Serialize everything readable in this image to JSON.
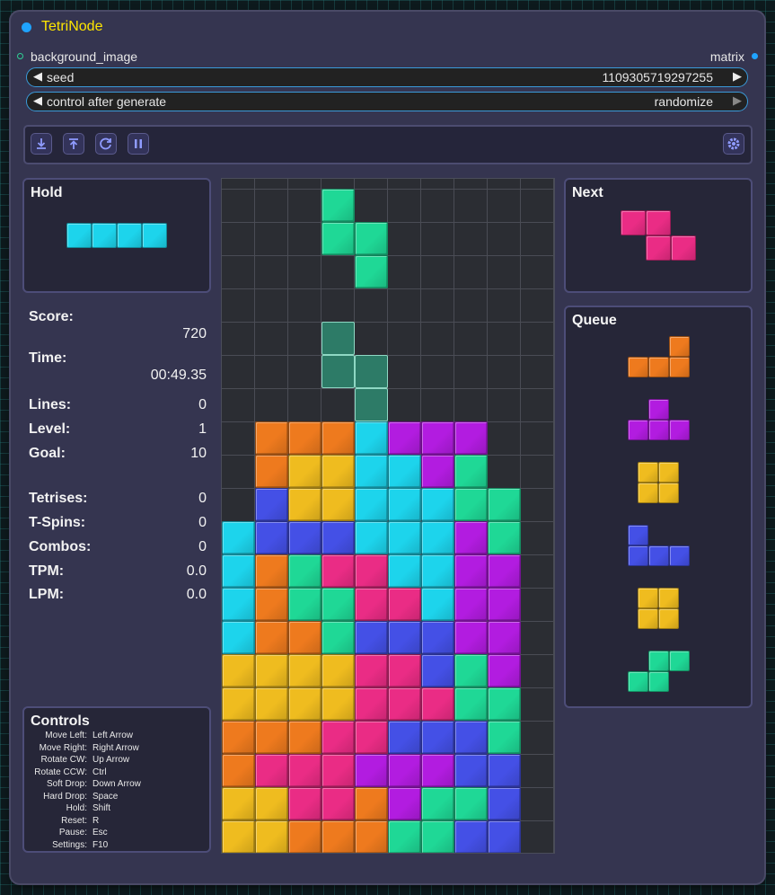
{
  "node": {
    "title": "TetriNode",
    "input_label": "background_image",
    "output_label": "matrix"
  },
  "widgets": {
    "seed": {
      "label": "seed",
      "value": "1109305719297255"
    },
    "control": {
      "label": "control after generate",
      "value": "randomize"
    }
  },
  "toolbar": {
    "icons": [
      "download-icon",
      "upload-icon",
      "reset-icon",
      "pause-icon",
      "gear-icon"
    ]
  },
  "hold": {
    "title": "Hold",
    "piece": "I"
  },
  "next": {
    "title": "Next",
    "piece": "Z"
  },
  "queue": {
    "title": "Queue",
    "pieces": [
      "L",
      "T",
      "O",
      "J",
      "O",
      "S"
    ]
  },
  "stats": {
    "score_label": "Score:",
    "score": "720",
    "time_label": "Time:",
    "time": "00:49.35",
    "lines_label": "Lines:",
    "lines": "0",
    "level_label": "Level:",
    "level": "1",
    "goal_label": "Goal:",
    "goal": "10",
    "tetrises_label": "Tetrises:",
    "tetrises": "0",
    "tspins_label": "T-Spins:",
    "tspins": "0",
    "combos_label": "Combos:",
    "combos": "0",
    "tpm_label": "TPM:",
    "tpm": "0.0",
    "lpm_label": "LPM:",
    "lpm": "0.0"
  },
  "controls": {
    "title": "Controls",
    "items": [
      {
        "action": "Move Left:",
        "key": "Left Arrow"
      },
      {
        "action": "Move Right:",
        "key": "Right Arrow"
      },
      {
        "action": "Rotate CW:",
        "key": "Up Arrow"
      },
      {
        "action": "Rotate CCW:",
        "key": "Ctrl"
      },
      {
        "action": "Soft Drop:",
        "key": "Down Arrow"
      },
      {
        "action": "Hard Drop:",
        "key": "Space"
      },
      {
        "action": "Hold:",
        "key": "Shift"
      },
      {
        "action": "Reset:",
        "key": "R"
      },
      {
        "action": "Pause:",
        "key": "Esc"
      },
      {
        "action": "Settings:",
        "key": "F10"
      }
    ]
  },
  "colors": {
    "I": "#1dd4ec",
    "O": "#efbc1f",
    "T": "#b21ce0",
    "S": "#1fd896",
    "Z": "#ea2c85",
    "J": "#4450e6",
    "L": "#ee7a1e",
    "ghost": "#2d7b67",
    "accent": "#1fa3ff",
    "title": "#ffe600"
  },
  "board": {
    "rows": [
      "..........",
      "...S......",
      "...SS.....",
      "....S.....",
      "..........",
      "...g......",
      "...gg.....",
      "....g.....",
      ".LLLITTT..",
      ".LOOIITS..",
      ".JOOIIISS.",
      "IJJJIIITS.",
      "ILSZZIITT.",
      "ILSSZZITT.",
      "ILLSJJJTT.",
      "OOOOZZJST.",
      "OOOOZZZSS.",
      "LLLZZJJJS.",
      "LZZZTTTJJ.",
      "OOZZLTSSJ.",
      "OOLLLSSJJ."
    ]
  }
}
